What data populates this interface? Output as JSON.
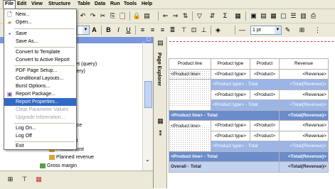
{
  "menubar": {
    "items": [
      "File",
      "Edit",
      "View",
      "Structure",
      "Table",
      "Data",
      "Run",
      "Tools",
      "Help"
    ]
  },
  "toolbar": {
    "font_size": "1 pt",
    "style_b": "B",
    "style_i": "I",
    "style_u": "U"
  },
  "file_menu": {
    "items": [
      {
        "label": "New...",
        "icon": "new-document-icon",
        "enabled": true
      },
      {
        "label": "Open...",
        "icon": "open-folder-icon",
        "enabled": true
      },
      {
        "label": "Save",
        "icon": "save-disk-icon",
        "enabled": true
      },
      {
        "label": "Save As...",
        "enabled": true
      },
      {
        "label": "Convert to Template",
        "enabled": true
      },
      {
        "label": "Convert to Active Report",
        "enabled": true
      },
      {
        "label": "PDF Page Setup...",
        "enabled": true
      },
      {
        "label": "Conditional Layouts...",
        "enabled": true
      },
      {
        "label": "Burst Options...",
        "enabled": true
      },
      {
        "label": "Report Package...",
        "icon": "package-icon",
        "enabled": true
      },
      {
        "label": "Report Properties...",
        "enabled": true,
        "highlighted": true
      },
      {
        "label": "Clear Parameter Values",
        "enabled": false
      },
      {
        "label": "Upgrade Information...",
        "enabled": false
      },
      {
        "label": "Log On...",
        "enabled": true
      },
      {
        "label": "Log Off",
        "enabled": true
      },
      {
        "label": "Exit",
        "enabled": true
      }
    ]
  },
  "tree": {
    "partial_items": [
      "rget (query)",
      "query)",
      "price",
      "ofit"
    ],
    "items": [
      {
        "label": "Product cost"
      },
      {
        "label": "Planned revenue"
      },
      {
        "label": "Gross margin"
      }
    ]
  },
  "strip": {
    "label": "Page Explorer"
  },
  "report": {
    "headers": [
      "Product line",
      "Product type",
      "Product",
      "Revenue"
    ],
    "first_row": {
      "product_line": "<Product line>",
      "product_type": "<Product type>",
      "product": "<Product>",
      "revenue": "<Revenue>"
    },
    "repeat_row": {
      "product_type": "<Product type>",
      "product": "<Product>",
      "revenue": "<Revenue>"
    },
    "type_total": {
      "label": "<Product type> - Total",
      "value": "<Total(Revenue)>"
    },
    "line_total": {
      "label": "<Product line> - Total",
      "value": "<Total(Revenue)>"
    },
    "second_line": "<Product line>",
    "overall": {
      "label": "Overall - Total",
      "value": "<Total(Revenue)>"
    }
  },
  "colors": {
    "highlight": "#316ac5",
    "total_light": "#9bb5e6",
    "total_dark": "#6a8cc9",
    "overall": "#c3d2ee"
  }
}
